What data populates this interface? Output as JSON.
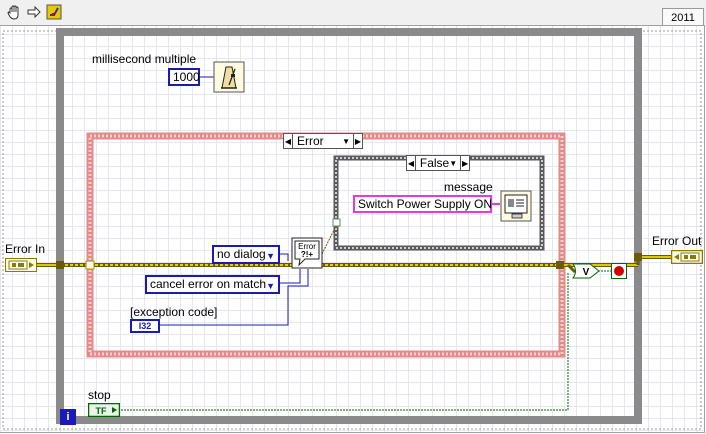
{
  "toolbar": {
    "icons": [
      "hand-icon",
      "arrow-icon",
      "highlight-execution-icon"
    ],
    "year_tab": "2011"
  },
  "while_loop": {
    "iteration_label": "i",
    "stop_label": "stop",
    "stop_terminal_text": "TF"
  },
  "wait": {
    "label": "millisecond multiple",
    "value": "1000"
  },
  "error_in": {
    "label": "Error In"
  },
  "error_out": {
    "label": "Error Out"
  },
  "outer_case": {
    "selector": "Error"
  },
  "inner_case": {
    "selector": "False"
  },
  "message": {
    "label": "message",
    "value": "Switch Power Supply ON"
  },
  "clear_errors": {
    "icon_text": "Error ?!+",
    "dialog_value": "no dialog",
    "cancel_value": "cancel error on match",
    "exception_label": "[exception code]",
    "exception_type": "I32"
  },
  "or_gate_text": "V",
  "colors": {
    "loop_border": "#8a8a8a",
    "case_border": "#e08080",
    "error_wire": "#b8b000",
    "numeric_wire": "#1a1ab8",
    "string_wire": "#e23be2",
    "boolean_wire": "#006600"
  }
}
